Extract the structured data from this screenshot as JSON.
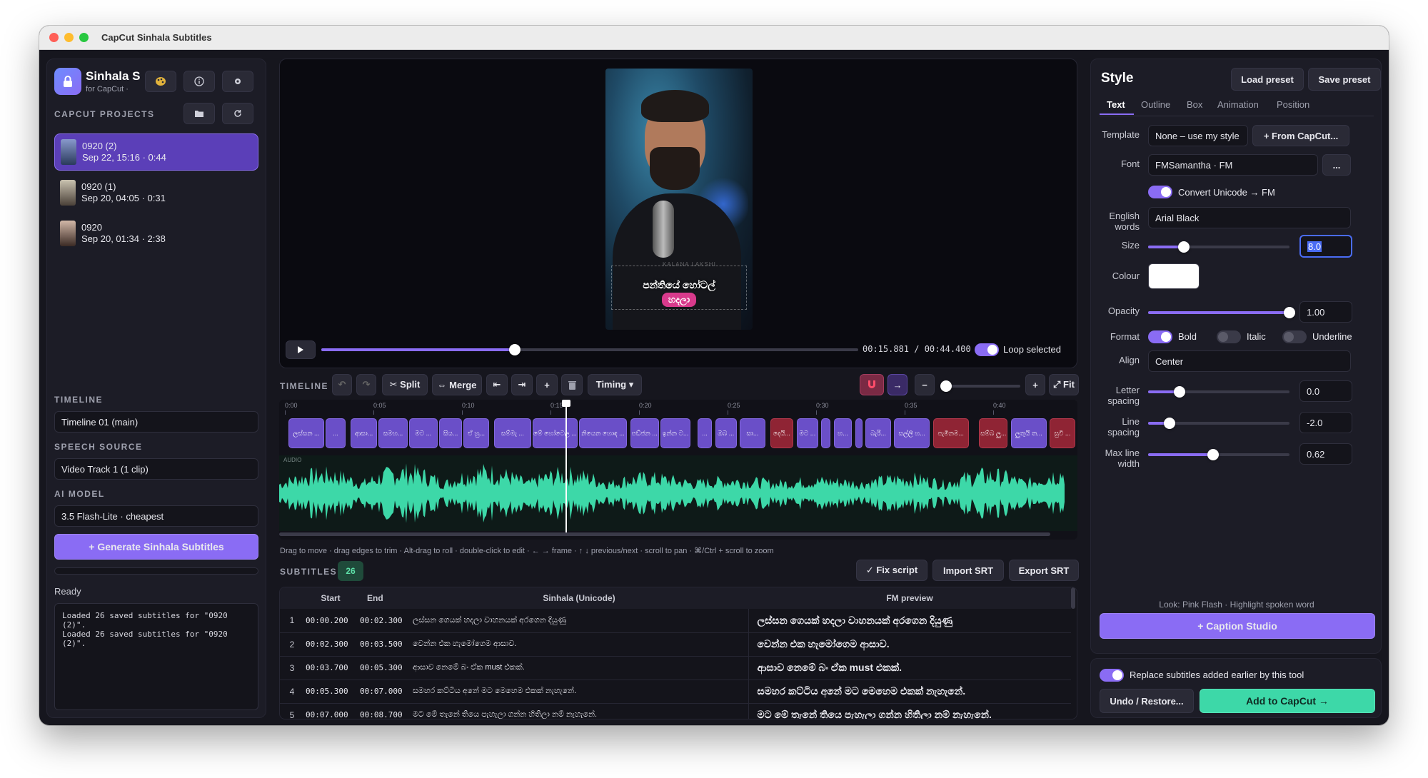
{
  "window": {
    "title": "CapCut Sinhala Subtitles"
  },
  "sidebar": {
    "app_name": "Sinhala S",
    "app_sub": "for CapCut ·",
    "projects_label": "CAPCUT PROJECTS",
    "projects": [
      {
        "name": "0920 (2)",
        "meta": "Sep 22, 15:16 · 0:44",
        "selected": true
      },
      {
        "name": "0920 (1)",
        "meta": "Sep 20, 04:05 · 0:31",
        "selected": false
      },
      {
        "name": "0920",
        "meta": "Sep 20, 01:34 · 2:38",
        "selected": false
      }
    ],
    "timeline_label": "TIMELINE",
    "timeline_value": "Timeline 01  (main)",
    "speech_label": "SPEECH SOURCE",
    "speech_value": "Video Track 1  (1 clip)",
    "model_label": "AI MODEL",
    "model_value": "3.5 Flash-Lite · cheapest",
    "generate_label": "+ Generate Sinhala Subtitles",
    "status": "Ready",
    "log": "Loaded 26 saved subtitles for \"0920 (2)\".\nLoaded 26 saved subtitles for \"0920 (2)\"."
  },
  "preview": {
    "caption_line1": "පන්තියේ හෝටල්",
    "caption_line2": "හදලා",
    "watermark": "KALANA LAKSHI",
    "time_readout": "00:15.881 / 00:44.400",
    "loop_label": "Loop selected",
    "progress": 0.36
  },
  "timeline": {
    "label": "TIMELINE",
    "split_label": "✂ Split",
    "merge_label": "⇔ Merge",
    "timing_label": "Timing ▾",
    "fit_label": "⤢ Fit",
    "ticks": [
      "0:00",
      "0:05",
      "0:10",
      "0:15",
      "0:20",
      "0:25",
      "0:30",
      "0:35",
      "0:40"
    ],
    "audio_label": "AUDIO",
    "clips": [
      {
        "text": "ලස්සන ...",
        "start": 0.2,
        "end": 2.3
      },
      {
        "text": "...",
        "start": 2.3,
        "end": 3.5
      },
      {
        "text": "ආසා...",
        "start": 3.7,
        "end": 5.3
      },
      {
        "text": "සමහ...",
        "start": 5.3,
        "end": 7.0
      },
      {
        "text": "මට ...",
        "start": 7.0,
        "end": 8.7
      },
      {
        "text": "සිය...",
        "start": 8.7,
        "end": 10.1
      },
      {
        "text": "ඒ හු...",
        "start": 10.1,
        "end": 11.6
      },
      {
        "text": "සම්මැ ...",
        "start": 11.8,
        "end": 14.0
      },
      {
        "text": "මේ හෝටෙල ...",
        "start": 14.0,
        "end": 16.6
      },
      {
        "text": "නියෙන හොඳ ...",
        "start": 16.6,
        "end": 19.4
      },
      {
        "text": "පඩ්ජන ...",
        "start": 19.5,
        "end": 21.2
      },
      {
        "text": "ඉන්න ට...",
        "start": 21.2,
        "end": 23.0
      },
      {
        "text": "...",
        "start": 23.3,
        "end": 24.2
      },
      {
        "text": "ඔබ ...",
        "start": 24.3,
        "end": 25.6
      },
      {
        "text": "සා...",
        "start": 25.7,
        "end": 27.2
      },
      {
        "text": "දෙයි...",
        "start": 27.4,
        "end": 28.8
      },
      {
        "text": "මට ...",
        "start": 28.9,
        "end": 30.2
      },
      {
        "text": "",
        "start": 30.3,
        "end": 30.9
      },
      {
        "text": "හ...",
        "start": 31.0,
        "end": 32.1
      },
      {
        "text": "",
        "start": 32.2,
        "end": 32.7
      },
      {
        "text": "බැරි...",
        "start": 32.8,
        "end": 34.3
      },
      {
        "text": "සල්ලි හ...",
        "start": 34.4,
        "end": 36.5
      },
      {
        "text": "පැමිනම...",
        "start": 36.6,
        "end": 38.7
      },
      {
        "text": "සම්බ ලු...",
        "start": 39.2,
        "end": 40.9
      },
      {
        "text": "ලුතුයි ත...",
        "start": 41.0,
        "end": 43.1
      },
      {
        "text": "සුවි ...",
        "start": 43.2,
        "end": 44.7
      }
    ],
    "hint": "Drag to move · drag edges to trim · Alt-drag to roll · double-click to edit · ← → frame · ↑ ↓ previous/next · scroll to pan · ⌘/Ctrl + scroll to zoom"
  },
  "subtitles": {
    "label": "SUBTITLES",
    "count": "26",
    "fix_label": "✓ Fix script",
    "import_label": "Import SRT",
    "export_label": "Export SRT",
    "headers": {
      "start": "Start",
      "end": "End",
      "sinhala": "Sinhala (Unicode)",
      "fm": "FM preview"
    },
    "rows": [
      {
        "n": "1",
        "start": "00:00.200",
        "end": "00:02.300",
        "text": "ලස්සන ගෙයක් හදලා වාහනයක් අරගෙන දියුණු",
        "fm": "ලස්සන ගෙයක් හදලා වාහනයක් අරගෙන දියුණු"
      },
      {
        "n": "2",
        "start": "00:02.300",
        "end": "00:03.500",
        "text": "වෙන්න එක හැමෝගෙම ආසාව.",
        "fm": "වෙන්න එක හැමෝගෙම ආසාව."
      },
      {
        "n": "3",
        "start": "00:03.700",
        "end": "00:05.300",
        "text": "ආසාව නෙමේ බං ඒක must එකක්.",
        "fm": "ආසාව නෙමේ බං ඒක must එකක්."
      },
      {
        "n": "4",
        "start": "00:05.300",
        "end": "00:07.000",
        "text": "සමහර කට්ටිය අනේ මට මෙහෙම එකක් නැහැනේ.",
        "fm": "සමහර කට්ටිය අනේ මට මෙහෙම එකක් නැහැනේ."
      },
      {
        "n": "5",
        "start": "00:07.000",
        "end": "00:08.700",
        "text": "මට මේ තැනේ තියෙ පැහැලා ගන්න හිතිලා නම් නැහැනේ.",
        "fm": "මට මේ තැනේ තියෙ පැහැලා ගන්න හිතිලා නම් නැහැනේ."
      }
    ]
  },
  "style": {
    "title": "Style",
    "load_preset": "Load preset",
    "save_preset": "Save preset",
    "tabs": [
      "Text",
      "Outline",
      "Box",
      "Animation",
      "Position"
    ],
    "active_tab": "Text",
    "template_label": "Template",
    "template_value": "None – use my style",
    "from_capcut": "+ From CapCut...",
    "font_label": "Font",
    "font_value": "FMSamantha  · FM",
    "font_more": "...",
    "convert_label": "Convert Unicode → FM",
    "english_label": "English words",
    "english_value": "Arial Black",
    "size_label": "Size",
    "size_value": "8.0",
    "size_level": 0.25,
    "colour_label": "Colour",
    "colour_value": "#ffffff",
    "opacity_label": "Opacity",
    "opacity_value": "1.00",
    "opacity_level": 1.0,
    "format_label": "Format",
    "bold_label": "Bold",
    "italic_label": "Italic",
    "underline_label": "Underline",
    "align_label": "Align",
    "align_value": "Center",
    "letter_label": "Letter spacing",
    "letter_value": "0.0",
    "letter_level": 0.22,
    "line_label": "Line spacing",
    "line_value": "-2.0",
    "line_level": 0.15,
    "maxw_label": "Max line width",
    "maxw_value": "0.62",
    "maxw_level": 0.46,
    "look_text": "Look: Pink Flash · Highlight spoken word",
    "caption_studio": "+ Caption Studio",
    "replace_label": "Replace subtitles added earlier by this tool",
    "undo_label": "Undo / Restore...",
    "add_label": "Add to CapCut →"
  },
  "colors": {
    "accent": "#8a6cf4",
    "teal": "#3dd8a8",
    "clip_purple": "#6a4fc8",
    "clip_red": "#8f2434"
  }
}
